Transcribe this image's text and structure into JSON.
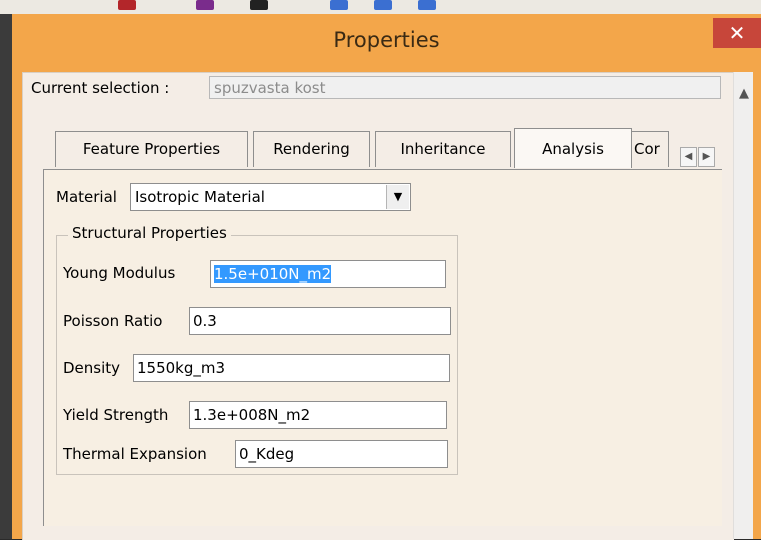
{
  "window": {
    "title": "Properties"
  },
  "current_selection": {
    "label": "Current selection :",
    "value": "spuzvasta kost"
  },
  "tabs": [
    {
      "label": "Feature Properties",
      "active": false
    },
    {
      "label": "Rendering",
      "active": false
    },
    {
      "label": "Inheritance",
      "active": false
    },
    {
      "label": "Analysis",
      "active": true
    },
    {
      "label": "Cor",
      "active": false
    }
  ],
  "material": {
    "label": "Material",
    "selected": "Isotropic Material"
  },
  "structural": {
    "title": "Structural Properties",
    "young_modulus": {
      "label": "Young Modulus",
      "value": "1.5e+010N_m2"
    },
    "poisson_ratio": {
      "label": "Poisson Ratio",
      "value": "0.3"
    },
    "density": {
      "label": "Density",
      "value": "1550kg_m3"
    },
    "yield_strength": {
      "label": "Yield Strength",
      "value": "1.3e+008N_m2"
    },
    "thermal_expansion": {
      "label": "Thermal Expansion",
      "value": "0_Kdeg"
    }
  },
  "colors": {
    "titlebar": "#f3a64a",
    "close": "#c7463a",
    "selection": "#3399ff"
  }
}
